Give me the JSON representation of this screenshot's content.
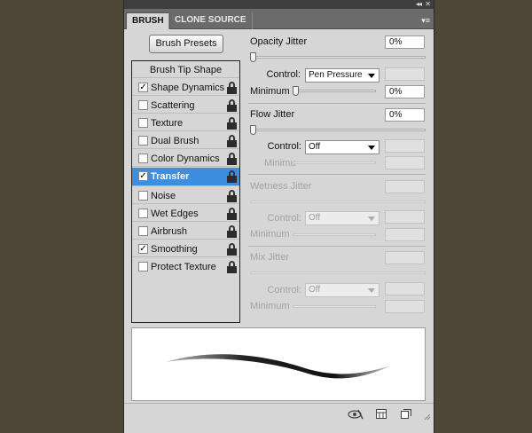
{
  "panel": {
    "tabs": [
      {
        "label": "BRUSH",
        "active": true
      },
      {
        "label": "CLONE SOURCE",
        "active": false
      }
    ],
    "collapse_glyph": "◂◂",
    "close_glyph": "✕",
    "menu_glyph": "▾≡",
    "brush_presets_label": "Brush Presets"
  },
  "options": {
    "header": "Brush Tip Shape",
    "items": [
      {
        "label": "Shape Dynamics",
        "checked": true,
        "locked": true,
        "selected": false
      },
      {
        "label": "Scattering",
        "checked": false,
        "locked": true,
        "selected": false
      },
      {
        "label": "Texture",
        "checked": false,
        "locked": true,
        "selected": false
      },
      {
        "label": "Dual Brush",
        "checked": false,
        "locked": true,
        "selected": false
      },
      {
        "label": "Color Dynamics",
        "checked": false,
        "locked": true,
        "selected": false
      },
      {
        "label": "Transfer",
        "checked": true,
        "locked": true,
        "selected": true
      },
      {
        "label": "Noise",
        "checked": false,
        "locked": true,
        "selected": false
      },
      {
        "label": "Wet Edges",
        "checked": false,
        "locked": true,
        "selected": false
      },
      {
        "label": "Airbrush",
        "checked": false,
        "locked": true,
        "selected": false
      },
      {
        "label": "Smoothing",
        "checked": true,
        "locked": true,
        "selected": false
      },
      {
        "label": "Protect Texture",
        "checked": false,
        "locked": true,
        "selected": false
      }
    ],
    "check_glyph": "✓"
  },
  "transfer": {
    "opacity_jitter": {
      "label": "Opacity Jitter",
      "value": "0%",
      "slider_fraction": 0,
      "control_label": "Control:",
      "control_value": "Pen Pressure",
      "minimum_label": "Minimum",
      "minimum_value": "0%",
      "minimum_fraction": 0
    },
    "flow_jitter": {
      "label": "Flow Jitter",
      "value": "0%",
      "slider_fraction": 0,
      "control_label": "Control:",
      "control_value": "Off",
      "minimum_label": "Minimu"
    },
    "wetness_jitter": {
      "label": "Wetness Jitter",
      "control_label": "Control:",
      "control_value": "Off",
      "minimum_label": "Minimum"
    },
    "mix_jitter": {
      "label": "Mix Jitter",
      "control_label": "Control:",
      "control_value": "Off",
      "minimum_label": "Minimum"
    }
  },
  "colors": {
    "background": "#4d4737",
    "panel": "#d6d6d6",
    "selected": "#3d8ee0"
  },
  "bottom_icons": [
    "eye-brush-icon",
    "grid-panel-icon",
    "new-brush-icon"
  ]
}
